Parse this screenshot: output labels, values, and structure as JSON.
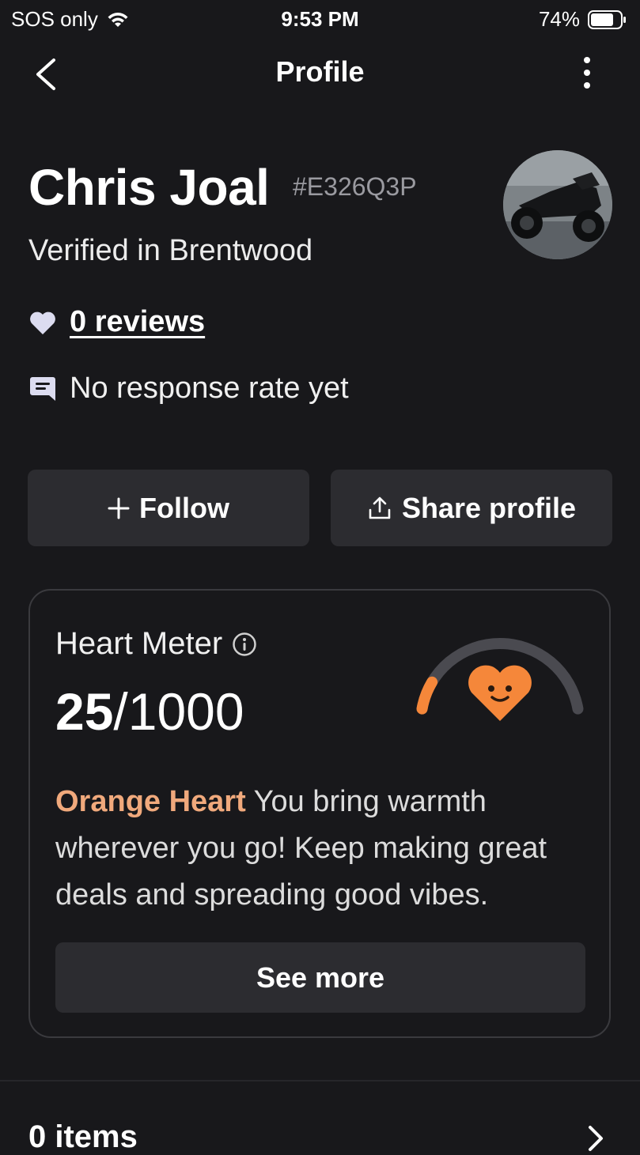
{
  "status_bar": {
    "carrier": "SOS only",
    "time": "9:53 PM",
    "battery": "74%"
  },
  "nav": {
    "title": "Profile",
    "back_icon": "chevron-left-icon",
    "more_icon": "more-vertical-icon"
  },
  "profile": {
    "name": "Chris Joal",
    "code": "#E326Q3P",
    "verified": "Verified in Brentwood",
    "reviews": "0 reviews",
    "response_rate": "No response rate yet"
  },
  "actions": {
    "follow_label": "Follow",
    "share_label": "Share profile"
  },
  "heart_meter": {
    "title": "Heart Meter",
    "score": "25",
    "max": "/1000",
    "score_value": 25,
    "max_value": 1000,
    "level": "Orange Heart",
    "description": " You bring warmth wherever you go! Keep making great deals and spreading good vibes.",
    "see_more": "See more",
    "accent_color": "#f5873a",
    "track_color": "#4a4a50"
  },
  "items_section": {
    "label": "0 items"
  }
}
